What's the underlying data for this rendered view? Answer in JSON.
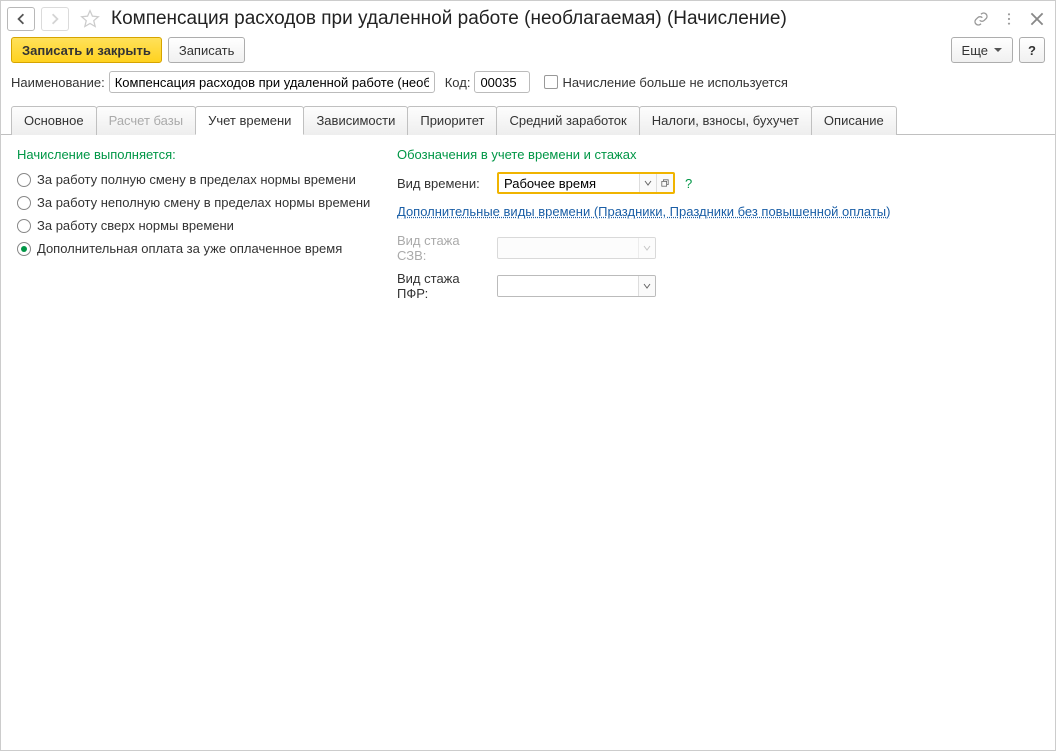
{
  "header": {
    "title": "Компенсация расходов при удаленной работе (необлагаемая) (Начисление)"
  },
  "toolbar": {
    "save_close": "Записать и закрыть",
    "save": "Записать",
    "more": "Еще",
    "help": "?"
  },
  "fields": {
    "name_label": "Наименование:",
    "name_value": "Компенсация расходов при удаленной работе (необлагаемая)",
    "code_label": "Код:",
    "code_value": "00035",
    "not_used_label": "Начисление больше не используется"
  },
  "tabs": [
    {
      "label": "Основное",
      "active": false
    },
    {
      "label": "Расчет базы",
      "disabled": true
    },
    {
      "label": "Учет времени",
      "active": true
    },
    {
      "label": "Зависимости"
    },
    {
      "label": "Приоритет"
    },
    {
      "label": "Средний заработок"
    },
    {
      "label": "Налоги, взносы, бухучет"
    },
    {
      "label": "Описание"
    }
  ],
  "left_section": {
    "title": "Начисление выполняется:",
    "radios": [
      {
        "label": "За работу полную смену в пределах нормы времени",
        "checked": false
      },
      {
        "label": "За работу неполную смену в пределах нормы времени",
        "checked": false
      },
      {
        "label": "За работу сверх нормы времени",
        "checked": false
      },
      {
        "label": "Дополнительная оплата за уже оплаченное время",
        "checked": true
      }
    ]
  },
  "right_section": {
    "title": "Обозначения в учете времени и стажах",
    "time_type_label": "Вид времени:",
    "time_type_value": "Рабочее время",
    "help_q": "?",
    "extra_link": "Дополнительные виды времени (Праздники, Праздники без повышенной оплаты)",
    "szv_label": "Вид стажа СЗВ:",
    "szv_value": "",
    "pfr_label": "Вид стажа ПФР:",
    "pfr_value": ""
  }
}
